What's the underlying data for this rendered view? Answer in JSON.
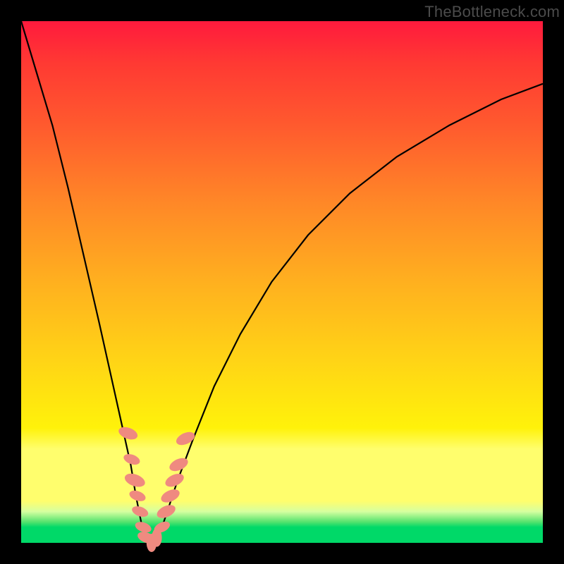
{
  "watermark": "TheBottleneck.com",
  "colors": {
    "frame": "#000000",
    "gradient_top": "#ff1a3d",
    "gradient_mid1": "#ff8827",
    "gradient_mid2": "#fff20a",
    "gradient_band": "#fffe6d",
    "gradient_bottom": "#00d968",
    "curve": "#000000",
    "marker": "#ef8a80"
  },
  "chart_data": {
    "type": "line",
    "title": "",
    "xlabel": "",
    "ylabel": "",
    "xlim": [
      0,
      100
    ],
    "ylim": [
      0,
      100
    ],
    "background": "vertical-gradient-red-to-green",
    "series": [
      {
        "name": "bottleneck-curve",
        "x": [
          0,
          3,
          6,
          9,
          12,
          15,
          17,
          19,
          21,
          22,
          23,
          24,
          25,
          26,
          27,
          28,
          30,
          33,
          37,
          42,
          48,
          55,
          63,
          72,
          82,
          92,
          100
        ],
        "y": [
          100,
          90,
          80,
          68,
          55,
          42,
          33,
          24,
          15,
          9,
          4,
          1,
          0,
          1,
          3,
          6,
          12,
          20,
          30,
          40,
          50,
          59,
          67,
          74,
          80,
          85,
          88
        ]
      }
    ],
    "markers": [
      {
        "name": "cluster-left-upper",
        "x": 20.5,
        "y": 21,
        "r": 1.4
      },
      {
        "name": "cluster-left-a",
        "x": 21.2,
        "y": 16,
        "r": 1.2
      },
      {
        "name": "cluster-left-b",
        "x": 21.8,
        "y": 12,
        "r": 1.5
      },
      {
        "name": "cluster-left-c",
        "x": 22.3,
        "y": 9,
        "r": 1.2
      },
      {
        "name": "cluster-left-d",
        "x": 22.8,
        "y": 6,
        "r": 1.2
      },
      {
        "name": "cluster-left-e",
        "x": 23.4,
        "y": 3,
        "r": 1.2
      },
      {
        "name": "trough-a",
        "x": 24.0,
        "y": 1,
        "r": 1.3
      },
      {
        "name": "trough-b",
        "x": 25.0,
        "y": 0,
        "r": 1.3
      },
      {
        "name": "trough-c",
        "x": 26.0,
        "y": 1,
        "r": 1.3
      },
      {
        "name": "cluster-right-a",
        "x": 27.0,
        "y": 3,
        "r": 1.2
      },
      {
        "name": "cluster-right-b",
        "x": 27.8,
        "y": 6,
        "r": 1.4
      },
      {
        "name": "cluster-right-c",
        "x": 28.6,
        "y": 9,
        "r": 1.4
      },
      {
        "name": "cluster-right-d",
        "x": 29.4,
        "y": 12,
        "r": 1.4
      },
      {
        "name": "cluster-right-e",
        "x": 30.2,
        "y": 15,
        "r": 1.4
      },
      {
        "name": "cluster-right-upper",
        "x": 31.5,
        "y": 20,
        "r": 1.4
      }
    ]
  }
}
